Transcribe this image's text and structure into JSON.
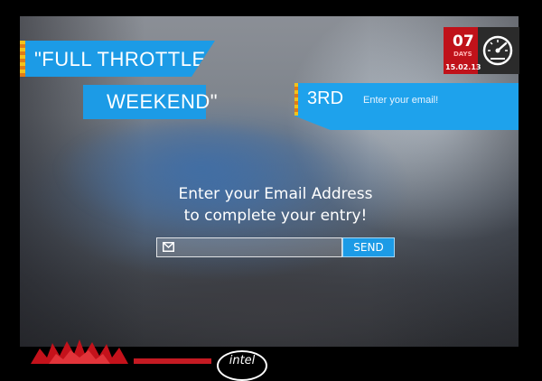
{
  "banner": {
    "line1": "\"FULL THROTTLE",
    "line2": "WEEKEND\""
  },
  "entry": {
    "rank": "3RD",
    "hint": "Enter your email!"
  },
  "timer": {
    "value": "07",
    "unit": "DAYS",
    "date": "15.02.13",
    "icon": "speedometer-icon"
  },
  "prompt": {
    "line1": "Enter your Email Address",
    "line2": "to complete your entry!"
  },
  "form": {
    "email_value": "",
    "email_placeholder": "",
    "send_label": "SEND",
    "icon": "mail-icon"
  },
  "footer": {
    "sponsor_text": "",
    "intel_logo": "intel"
  },
  "colors": {
    "accent": "#1c9be6",
    "timer_red": "#c0121a",
    "stripe": "#f2c21b"
  }
}
